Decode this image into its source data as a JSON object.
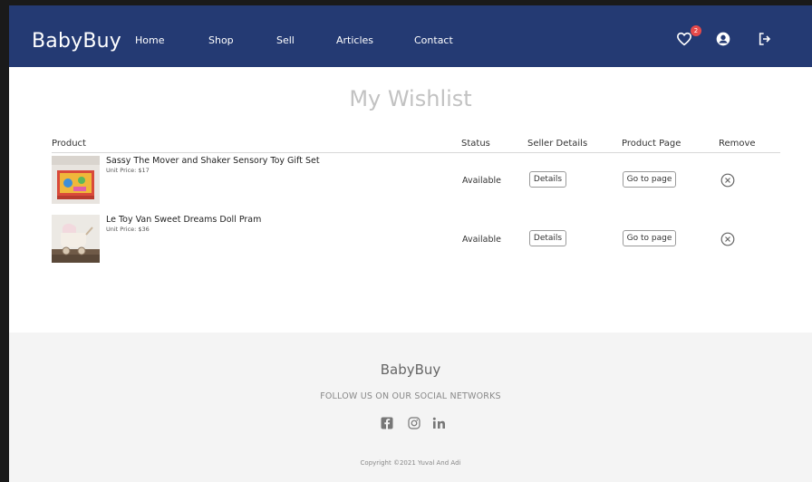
{
  "navbar": {
    "brand": "BabyBuy",
    "links": [
      "Home",
      "Shop",
      "Sell",
      "Articles",
      "Contact"
    ],
    "wishlist_count": "2",
    "icons": [
      "heart-icon",
      "user-circle-icon",
      "sign-out-icon"
    ]
  },
  "page": {
    "title": "My Wishlist"
  },
  "table": {
    "headers": [
      "Product",
      "Status",
      "Seller Details",
      "Product Page",
      "Remove"
    ],
    "rows": [
      {
        "name": "Sassy The Mover and Shaker Sensory Toy Gift Set",
        "price": "Unit Price: $17",
        "status": "Available",
        "details_label": "Details",
        "page_label": "Go to page"
      },
      {
        "name": "Le Toy Van Sweet Dreams Doll Pram",
        "price": "Unit Price: $36",
        "status": "Available",
        "details_label": "Details",
        "page_label": "Go to page"
      }
    ]
  },
  "footer": {
    "brand": "BabyBuy",
    "follow": "FOLLOW US ON OUR SOCIAL NETWORKS",
    "social": [
      "facebook-icon",
      "instagram-icon",
      "linkedin-icon"
    ],
    "copyright": "Copyright ©2021 Yuval And Adi"
  },
  "colors": {
    "navbar": "#243a73",
    "badge": "#e74a4a",
    "footer": "#f4f4f4",
    "title": "#c2c2c2"
  }
}
